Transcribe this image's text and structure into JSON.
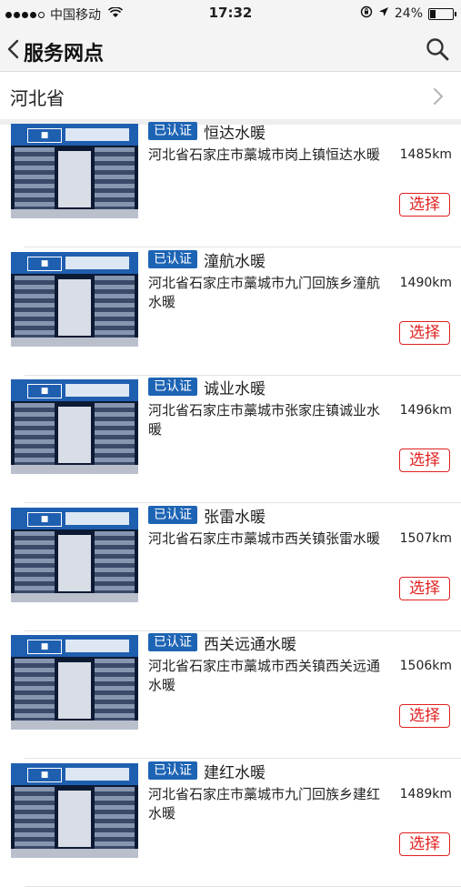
{
  "status_bar": {
    "carrier": "中国移动",
    "time": "17:32",
    "battery_percent": "24%",
    "battery_level": 0.24
  },
  "navbar": {
    "title": "服务网点",
    "back_icon": "chevron-left-icon",
    "search_icon": "search-icon"
  },
  "province_selector": {
    "label": "河北省",
    "icon": "chevron-right-icon"
  },
  "stores": [
    {
      "badge": "已认证",
      "name": "恒达水暖",
      "address": "河北省石家庄市藁城市岗上镇恒达水暖",
      "distance": "1485km",
      "select_label": "选择"
    },
    {
      "badge": "已认证",
      "name": "潼航水暖",
      "address": "河北省石家庄市藁城市九门回族乡潼航水暖",
      "distance": "1490km",
      "select_label": "选择"
    },
    {
      "badge": "已认证",
      "name": "诚业水暖",
      "address": "河北省石家庄市藁城市张家庄镇诚业水暖",
      "distance": "1496km",
      "select_label": "选择"
    },
    {
      "badge": "已认证",
      "name": "张雷水暖",
      "address": "河北省石家庄市藁城市西关镇张雷水暖",
      "distance": "1507km",
      "select_label": "选择"
    },
    {
      "badge": "已认证",
      "name": "西关远通水暖",
      "address": "河北省石家庄市藁城市西关镇西关远通水暖",
      "distance": "1506km",
      "select_label": "选择"
    },
    {
      "badge": "已认证",
      "name": "建红水暖",
      "address": "河北省石家庄市藁城市九门回族乡建红水暖",
      "distance": "1489km",
      "select_label": "选择"
    }
  ],
  "colors": {
    "badge_blue": "#1e64b4",
    "select_red": "#e02020",
    "bar_background": "#f4f4f4"
  }
}
